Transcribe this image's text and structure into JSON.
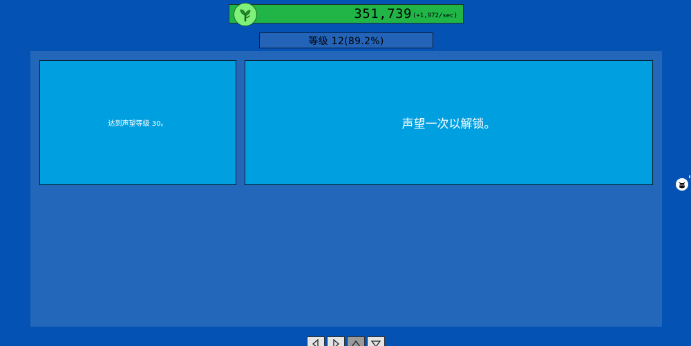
{
  "currency": {
    "amount": "351,739",
    "rate": "(+1,972/sec)",
    "icon": "sprout-icon",
    "bar_color": "#21b548"
  },
  "level": {
    "text": "等级 12(89.2%)"
  },
  "cards": [
    {
      "text": "达到声望等级 30。"
    },
    {
      "text": "声望一次以解锁。"
    }
  ],
  "side": {
    "icon": "cat-avatar-icon"
  },
  "navigation": {
    "buttons": [
      {
        "icon": "arrow-left-icon"
      },
      {
        "icon": "arrow-right-icon"
      },
      {
        "icon": "arrow-up-icon",
        "selected": true
      },
      {
        "icon": "arrow-down-icon"
      }
    ]
  }
}
